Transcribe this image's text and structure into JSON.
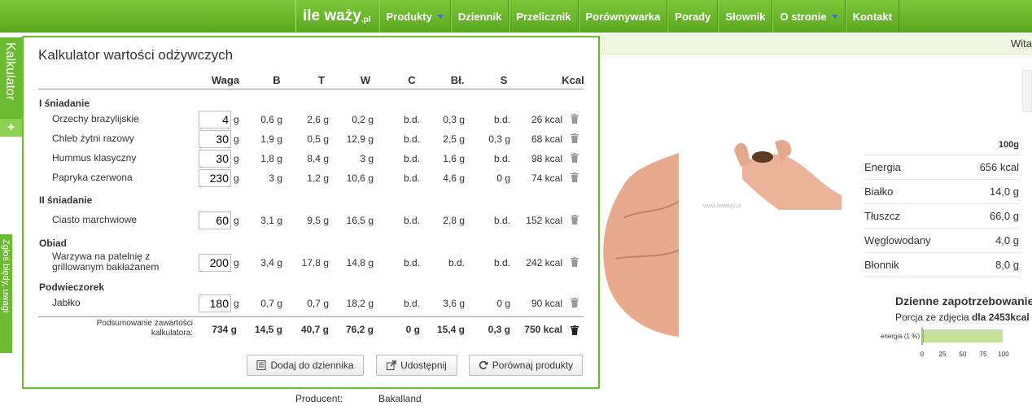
{
  "nav": {
    "logo_main": "ile waży",
    "logo_suffix": ".pl",
    "items": [
      "Produkty",
      "Dziennik",
      "Przelicznik",
      "Porównywarka",
      "Porady",
      "Słownik",
      "O stronie",
      "Kontakt"
    ]
  },
  "subbar": {
    "greeting": "Wita"
  },
  "side_tabs": {
    "calculator": "Kalkulator",
    "plus": "+",
    "bug": "Zgłoś błędy, uwagi"
  },
  "calculator": {
    "title": "Kalkulator wartości odżywczych",
    "columns": [
      "Waga",
      "B",
      "T",
      "W",
      "C",
      "Bł.",
      "S",
      "Kcal"
    ],
    "unit": "g",
    "sections": [
      {
        "name": "I śniadanie",
        "rows": [
          {
            "name": "Orzechy brazylijskie",
            "qty": "4",
            "b": "0,6 g",
            "t": "2,6 g",
            "w": "0,2 g",
            "c": "b.d.",
            "bl": "0,3 g",
            "s": "b.d.",
            "kcal": "26 kcal"
          },
          {
            "name": "Chleb żytni razowy",
            "qty": "30",
            "b": "1,9 g",
            "t": "0,5 g",
            "w": "12,9 g",
            "c": "b.d.",
            "bl": "2,5 g",
            "s": "0,3 g",
            "kcal": "68 kcal"
          },
          {
            "name": "Hummus klasyczny",
            "qty": "30",
            "b": "1,8 g",
            "t": "8,4 g",
            "w": "3 g",
            "c": "b.d.",
            "bl": "1,6 g",
            "s": "b.d.",
            "kcal": "98 kcal"
          },
          {
            "name": "Papryka czerwona",
            "qty": "230",
            "b": "3 g",
            "t": "1,2 g",
            "w": "10,6 g",
            "c": "b.d.",
            "bl": "4,6 g",
            "s": "0 g",
            "kcal": "74 kcal"
          }
        ]
      },
      {
        "name": "II śniadanie",
        "rows": [
          {
            "name": "Ciasto marchwiowe",
            "qty": "60",
            "b": "3,1 g",
            "t": "9,5 g",
            "w": "16,5 g",
            "c": "b.d.",
            "bl": "2,8 g",
            "s": "b.d.",
            "kcal": "152 kcal"
          }
        ]
      },
      {
        "name": "Obiad",
        "rows": [
          {
            "name": "Warzywa na patelnię z grillowanym bakłażanem",
            "qty": "200",
            "b": "3,4 g",
            "t": "17,8 g",
            "w": "14,8 g",
            "c": "b.d.",
            "bl": "b.d.",
            "s": "b.d.",
            "kcal": "242 kcal"
          }
        ]
      },
      {
        "name": "Podwieczorek",
        "rows": [
          {
            "name": "Jabłko",
            "qty": "180",
            "b": "0,7 g",
            "t": "0,7 g",
            "w": "18,2 g",
            "c": "b.d.",
            "bl": "3,6 g",
            "s": "0 g",
            "kcal": "90 kcal"
          }
        ]
      }
    ],
    "summary": {
      "label": "Podsumowanie zawartości kalkulatora:",
      "waga": "734 g",
      "b": "14,5 g",
      "t": "40,7 g",
      "w": "76,2 g",
      "c": "0 g",
      "bl": "15,4 g",
      "s": "0,3 g",
      "kcal": "750 kcal"
    },
    "buttons": {
      "add": "Dodaj do dziennika",
      "share": "Udostępnij",
      "compare": "Porównaj produkty"
    }
  },
  "nutrition": {
    "header": "100g",
    "rows": [
      {
        "label": "Energia",
        "value": "656 kcal"
      },
      {
        "label": "Białko",
        "value": "14,0 g"
      },
      {
        "label": "Tłuszcz",
        "value": "66,0 g"
      },
      {
        "label": "Węglowodany",
        "value": "4,0 g"
      },
      {
        "label": "Błonnik",
        "value": "8,0 g"
      }
    ]
  },
  "daily": {
    "title": "Dzienne zapotrzebowanie",
    "subtitle_prefix": "Porcja ze zdjęcia ",
    "subtitle_bold": "dla 2453kcal"
  },
  "chart_data": {
    "type": "bar",
    "categories": [
      "energia (1 %)"
    ],
    "values": [
      1
    ],
    "xlim": [
      0,
      100
    ],
    "xticks": [
      "0",
      "25",
      "50",
      "75",
      "100"
    ],
    "bar_color": "#c6e29a"
  },
  "watermark": "www.ilewazy.pl",
  "producer": {
    "label": "Producent:",
    "value": "Bakalland"
  },
  "colors": {
    "green": "#6abb2f",
    "nav_blue_caret": "#2e7fb8"
  }
}
